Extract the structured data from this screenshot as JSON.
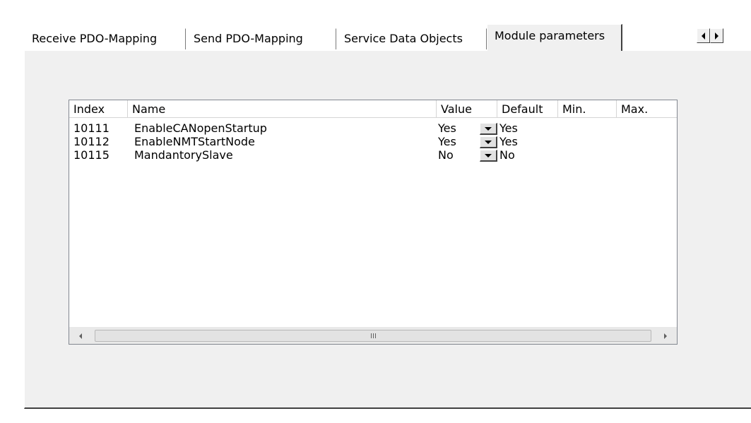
{
  "tabs": [
    {
      "label": "Receive PDO-Mapping"
    },
    {
      "label": "Send PDO-Mapping"
    },
    {
      "label": "Service Data Objects"
    },
    {
      "label": "Module parameters"
    }
  ],
  "active_tab": "Module parameters",
  "table": {
    "columns": [
      "Index",
      "Name",
      "Value",
      "Default",
      "Min.",
      "Max."
    ],
    "rows": [
      {
        "index": "10111",
        "name": "EnableCANopenStartup",
        "value": "Yes",
        "default": "Yes",
        "min": "",
        "max": ""
      },
      {
        "index": "10112",
        "name": "EnableNMTStartNode",
        "value": "Yes",
        "default": "Yes",
        "min": "",
        "max": ""
      },
      {
        "index": "10115",
        "name": "MandantorySlave",
        "value": "No",
        "default": "No",
        "min": "",
        "max": ""
      }
    ]
  },
  "icons": {
    "tab_scroll_left": "triangle-left-icon",
    "tab_scroll_right": "triangle-right-icon",
    "dropdown": "chevron-down-icon",
    "scrollbar_left": "arrow-left-icon",
    "scrollbar_right": "arrow-right-icon",
    "scrollbar_grip": "grip-icon"
  },
  "colors": {
    "panel_background": "#f0f0f0",
    "list_background": "#ffffff",
    "list_border": "#828790"
  }
}
